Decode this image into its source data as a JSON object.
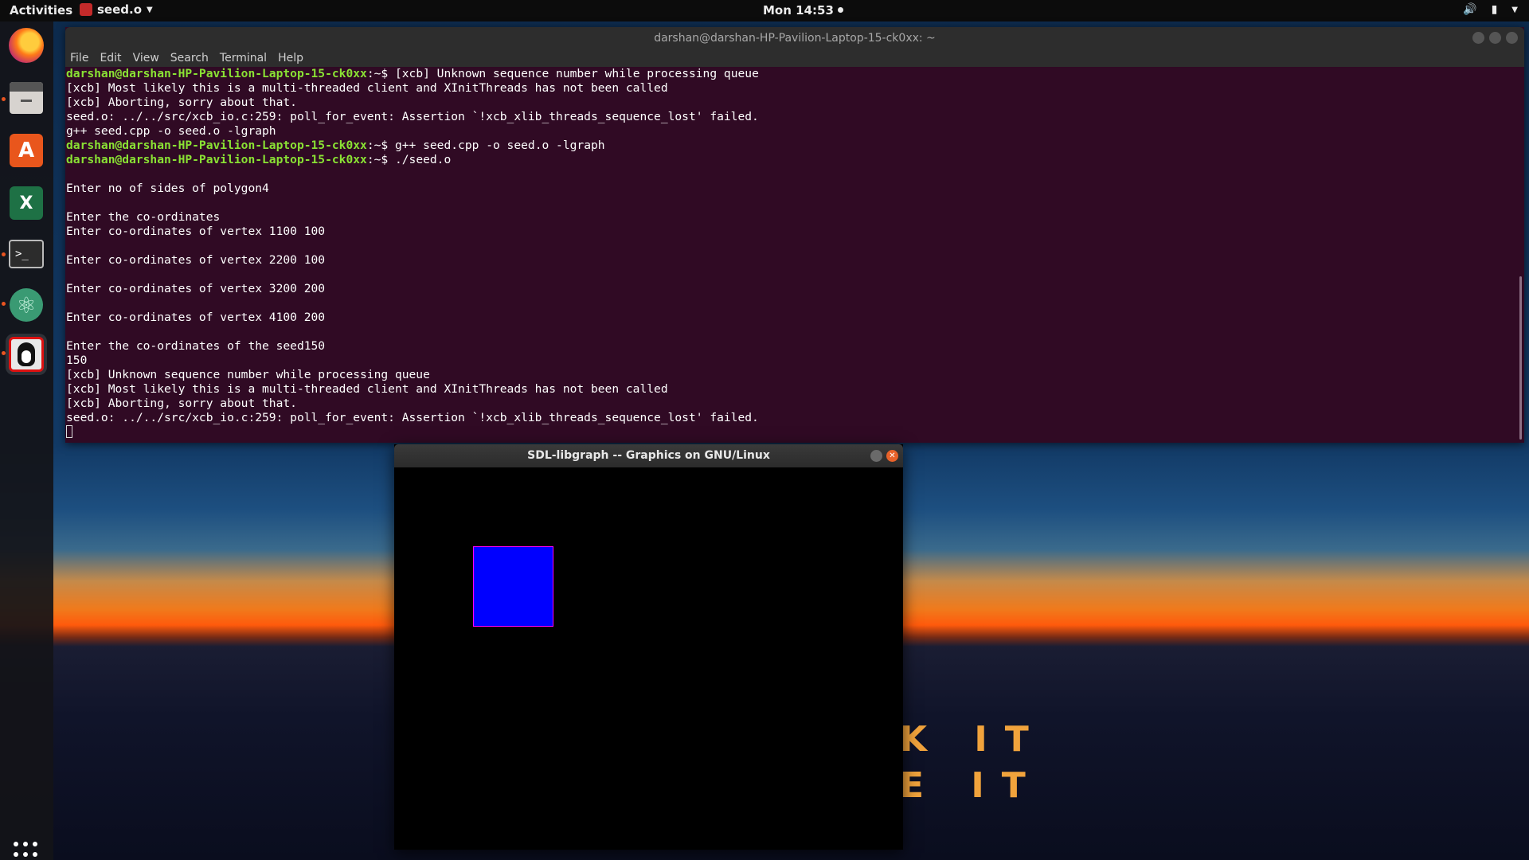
{
  "topbar": {
    "activities": "Activities",
    "app_name": "seed.o",
    "clock": "Mon 14:53"
  },
  "dock": {
    "items": [
      {
        "name": "Firefox",
        "icon": "firefox-icon",
        "running": false
      },
      {
        "name": "Files",
        "icon": "files-icon",
        "running": true
      },
      {
        "name": "Ubuntu Software",
        "icon": "software-icon",
        "running": false
      },
      {
        "name": "Spreadsheet",
        "icon": "spreadsheet-icon",
        "running": false
      },
      {
        "name": "Terminal",
        "icon": "terminal-icon",
        "running": true
      },
      {
        "name": "Atom",
        "icon": "atom-icon",
        "running": true
      },
      {
        "name": "seed.o",
        "icon": "tux-icon",
        "running": true
      }
    ]
  },
  "terminal": {
    "title": "darshan@darshan-HP-Pavilion-Laptop-15-ck0xx: ~",
    "menu": [
      "File",
      "Edit",
      "View",
      "Search",
      "Terminal",
      "Help"
    ],
    "lines": [
      {
        "prompt": "darshan@darshan-HP-Pavilion-Laptop-15-ck0xx",
        "sep": ":~$ ",
        "text": "[xcb] Unknown sequence number while processing queue"
      },
      {
        "text": "[xcb] Most likely this is a multi-threaded client and XInitThreads has not been called"
      },
      {
        "text": "[xcb] Aborting, sorry about that."
      },
      {
        "text": "seed.o: ../../src/xcb_io.c:259: poll_for_event: Assertion `!xcb_xlib_threads_sequence_lost' failed."
      },
      {
        "text": "g++ seed.cpp -o seed.o -lgraph"
      },
      {
        "prompt": "darshan@darshan-HP-Pavilion-Laptop-15-ck0xx",
        "sep": ":~$ ",
        "text": "g++ seed.cpp -o seed.o -lgraph"
      },
      {
        "prompt": "darshan@darshan-HP-Pavilion-Laptop-15-ck0xx",
        "sep": ":~$ ",
        "text": "./seed.o"
      },
      {
        "text": ""
      },
      {
        "text": "Enter no of sides of polygon4"
      },
      {
        "text": ""
      },
      {
        "text": "Enter the co-ordinates"
      },
      {
        "text": "Enter co-ordinates of vertex 1100 100"
      },
      {
        "text": ""
      },
      {
        "text": "Enter co-ordinates of vertex 2200 100"
      },
      {
        "text": ""
      },
      {
        "text": "Enter co-ordinates of vertex 3200 200"
      },
      {
        "text": ""
      },
      {
        "text": "Enter co-ordinates of vertex 4100 200"
      },
      {
        "text": ""
      },
      {
        "text": "Enter the co-ordinates of the seed150"
      },
      {
        "text": "150"
      },
      {
        "text": "[xcb] Unknown sequence number while processing queue"
      },
      {
        "text": "[xcb] Most likely this is a multi-threaded client and XInitThreads has not been called"
      },
      {
        "text": "[xcb] Aborting, sorry about that."
      },
      {
        "text": "seed.o: ../../src/xcb_io.c:259: poll_for_event: Assertion `!xcb_xlib_threads_sequence_lost' failed."
      }
    ]
  },
  "sdl_window": {
    "title": "SDL-libgraph -- Graphics on GNU/Linux",
    "fill_color": "#0000ff",
    "border_color": "#ff00ff"
  },
  "wallpaper": {
    "line1": "K IT",
    "line2": "E IT"
  },
  "colors": {
    "terminal_bg": "#300a24",
    "prompt": "#8ae234",
    "accent": "#e95420"
  }
}
